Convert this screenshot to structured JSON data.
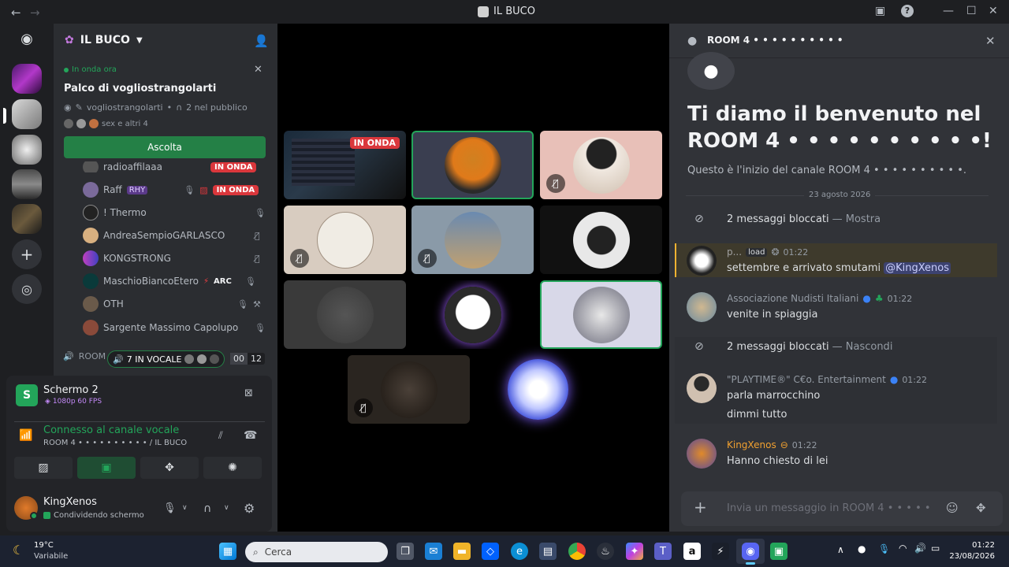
{
  "window": {
    "title": "IL BUCO"
  },
  "server": {
    "name": "IL BUCO"
  },
  "now_live": {
    "badge": "In onda ora",
    "title": "Palco di vogliostrangolarti",
    "host": "vogliostrangolarti",
    "audience": "2 nel pubblico",
    "participants": "sex e altri 4",
    "listen_button": "Ascolta"
  },
  "voice_users": [
    {
      "name": "radioaffilaaa",
      "live": "IN ONDA"
    },
    {
      "name": "Raff",
      "tag": "RHY",
      "live": "IN ONDA"
    },
    {
      "name": "! Thermo"
    },
    {
      "name": "AndreaSempioGARLASCO"
    },
    {
      "name": "KONGSTRONG"
    },
    {
      "name": "MaschioBiancoEtero",
      "tag": "ARC"
    },
    {
      "name": "OTH"
    },
    {
      "name": "Sargente Massimo Capolupo"
    }
  ],
  "room_row": {
    "label": "ROOM",
    "in_voice": "7 IN VOCALE",
    "count_a": "00",
    "count_b": "12"
  },
  "screen_share": {
    "title": "Schermo 2",
    "quality": "1080p 60 FPS"
  },
  "voice_status": {
    "connected": "Connesso al canale vocale",
    "channel": "ROOM 4 • • • • • • • • • • / IL BUCO"
  },
  "user": {
    "name": "KingXenos",
    "status": "Condividendo schermo"
  },
  "stage": {
    "live_label": "IN ONDA"
  },
  "chat": {
    "header": "ROOM 4 • • • • • • • • • •",
    "welcome_line1": "Ti diamo il benvenuto nel",
    "welcome_line2": "ROOM 4 • • • • • • • • • •!",
    "intro": "Questo è l'inizio del canale ROOM 4 • • • • • • • • • •.",
    "date_divider": "23 agosto 2026",
    "blocked1": {
      "text": "2 messaggi bloccati",
      "action": "— Mostra"
    },
    "messages": [
      {
        "author": "p...",
        "tag": "load",
        "time": "01:22",
        "lines": [
          "settembre e arrivato smutami"
        ],
        "mention": "@KingXenos"
      },
      {
        "author": "Associazione Nudisti Italiani",
        "time": "01:22",
        "lines": [
          "venite in spiaggia"
        ]
      },
      {
        "author": "\"PLAYTIME®\" C€o. Entertainment",
        "time": "01:22",
        "lines": [
          "parla marrocchino",
          "dimmi tutto"
        ]
      },
      {
        "author": "KingXenos",
        "time": "01:22",
        "lines": [
          "Hanno chiesto di lei"
        ]
      }
    ],
    "blocked2": {
      "text": "2 messaggi bloccati",
      "action": "— Nascondi"
    },
    "input_placeholder": "Invia un messaggio in ROOM 4 • • • • • • • • • •"
  },
  "taskbar": {
    "weather_temp": "19°C",
    "weather_desc": "Variabile",
    "search_placeholder": "Cerca",
    "time": "01:22",
    "date": "23/08/2026"
  },
  "colors": {
    "accent": "#5865f2",
    "green": "#248046",
    "live_red": "#da373c",
    "mention_bg": "#3c4270"
  }
}
